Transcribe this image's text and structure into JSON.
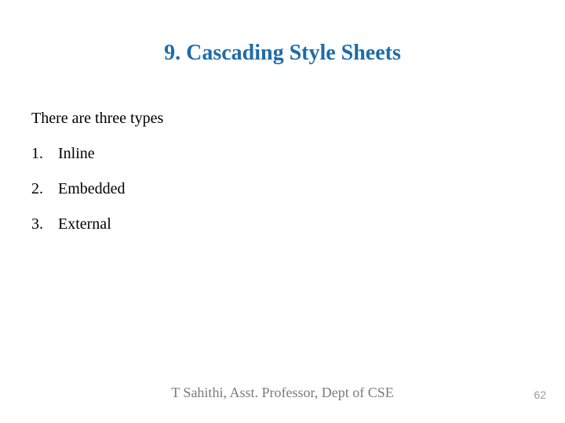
{
  "title": "9. Cascading Style Sheets",
  "intro": "There are three types",
  "items": [
    {
      "num": "1.",
      "label": "Inline"
    },
    {
      "num": "2.",
      "label": "Embedded"
    },
    {
      "num": "3.",
      "label": "External"
    }
  ],
  "footer": {
    "name": "T Sahithi, ",
    "role": "Asst. Professor, Dept of CSE"
  },
  "page_number": "62",
  "colors": {
    "title": "#1f6ca8",
    "footer": "#7a7a7a",
    "page_number": "#9a9a9a"
  }
}
